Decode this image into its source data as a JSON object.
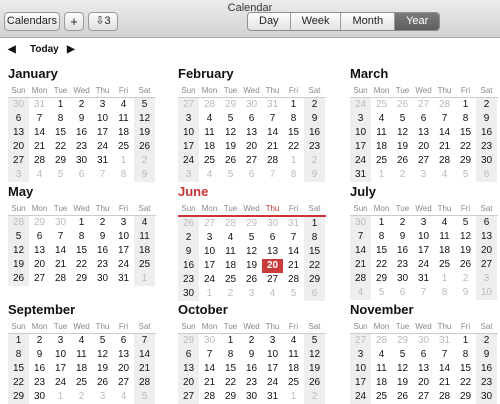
{
  "window": {
    "title": "Calendar"
  },
  "toolbar": {
    "calendars_label": "Calendars",
    "add_label": "+",
    "inbox_count": "3",
    "views": [
      "Day",
      "Week",
      "Month",
      "Year"
    ],
    "active_view": "Year"
  },
  "nav": {
    "today_label": "Today"
  },
  "weekdays": [
    "Sun",
    "Mon",
    "Tue",
    "Wed",
    "Thu",
    "Fri",
    "Sat"
  ],
  "months": [
    {
      "name": "January",
      "weeks": [
        [
          "30",
          "31",
          "1",
          "2",
          "3",
          "4",
          "5"
        ],
        [
          "6",
          "7",
          "8",
          "9",
          "10",
          "11",
          "12"
        ],
        [
          "13",
          "14",
          "15",
          "16",
          "17",
          "18",
          "19"
        ],
        [
          "20",
          "21",
          "22",
          "23",
          "24",
          "25",
          "26"
        ],
        [
          "27",
          "28",
          "29",
          "30",
          "31",
          "1",
          "2"
        ],
        [
          "3",
          "4",
          "5",
          "6",
          "7",
          "8",
          "9"
        ]
      ]
    },
    {
      "name": "February",
      "weeks": [
        [
          "27",
          "28",
          "29",
          "30",
          "31",
          "1",
          "2"
        ],
        [
          "3",
          "4",
          "5",
          "6",
          "7",
          "8",
          "9"
        ],
        [
          "10",
          "11",
          "12",
          "13",
          "14",
          "15",
          "16"
        ],
        [
          "17",
          "18",
          "19",
          "20",
          "21",
          "22",
          "23"
        ],
        [
          "24",
          "25",
          "26",
          "27",
          "28",
          "1",
          "2"
        ],
        [
          "3",
          "4",
          "5",
          "6",
          "7",
          "8",
          "9"
        ]
      ]
    },
    {
      "name": "March",
      "weeks": [
        [
          "24",
          "25",
          "26",
          "27",
          "28",
          "1",
          "2"
        ],
        [
          "3",
          "4",
          "5",
          "6",
          "7",
          "8",
          "9"
        ],
        [
          "10",
          "11",
          "12",
          "13",
          "14",
          "15",
          "16"
        ],
        [
          "17",
          "18",
          "19",
          "20",
          "21",
          "22",
          "23"
        ],
        [
          "24",
          "25",
          "26",
          "27",
          "28",
          "29",
          "30"
        ],
        [
          "31",
          "1",
          "2",
          "3",
          "4",
          "5",
          "6"
        ]
      ]
    },
    {
      "name": "May",
      "weeks": [
        [
          "28",
          "29",
          "30",
          "1",
          "2",
          "3",
          "4"
        ],
        [
          "5",
          "6",
          "7",
          "8",
          "9",
          "10",
          "11"
        ],
        [
          "12",
          "13",
          "14",
          "15",
          "16",
          "17",
          "18"
        ],
        [
          "19",
          "20",
          "21",
          "22",
          "23",
          "24",
          "25"
        ],
        [
          "26",
          "27",
          "28",
          "29",
          "30",
          "31",
          "1"
        ]
      ]
    },
    {
      "name": "June",
      "current": true,
      "weeks": [
        [
          "26",
          "27",
          "28",
          "29",
          "30",
          "31",
          "1"
        ],
        [
          "2",
          "3",
          "4",
          "5",
          "6",
          "7",
          "8"
        ],
        [
          "9",
          "10",
          "11",
          "12",
          "13",
          "14",
          "15"
        ],
        [
          "16",
          "17",
          "18",
          "19",
          "20",
          "21",
          "22"
        ],
        [
          "23",
          "24",
          "25",
          "26",
          "27",
          "28",
          "29"
        ],
        [
          "30",
          "1",
          "2",
          "3",
          "4",
          "5",
          "6"
        ]
      ]
    },
    {
      "name": "July",
      "weeks": [
        [
          "30",
          "1",
          "2",
          "3",
          "4",
          "5",
          "6"
        ],
        [
          "7",
          "8",
          "9",
          "10",
          "11",
          "12",
          "13"
        ],
        [
          "14",
          "15",
          "16",
          "17",
          "18",
          "19",
          "20"
        ],
        [
          "21",
          "22",
          "23",
          "24",
          "25",
          "26",
          "27"
        ],
        [
          "28",
          "29",
          "30",
          "31",
          "1",
          "2",
          "3"
        ],
        [
          "4",
          "5",
          "6",
          "7",
          "8",
          "9",
          "10"
        ]
      ]
    },
    {
      "name": "September",
      "weeks": [
        [
          "1",
          "2",
          "3",
          "4",
          "5",
          "6",
          "7"
        ],
        [
          "8",
          "9",
          "10",
          "11",
          "12",
          "13",
          "14"
        ],
        [
          "15",
          "16",
          "17",
          "18",
          "19",
          "20",
          "21"
        ],
        [
          "22",
          "23",
          "24",
          "25",
          "26",
          "27",
          "28"
        ],
        [
          "29",
          "30",
          "1",
          "2",
          "3",
          "4",
          "5"
        ]
      ]
    },
    {
      "name": "October",
      "weeks": [
        [
          "29",
          "30",
          "1",
          "2",
          "3",
          "4",
          "5"
        ],
        [
          "6",
          "7",
          "8",
          "9",
          "10",
          "11",
          "12"
        ],
        [
          "13",
          "14",
          "15",
          "16",
          "17",
          "18",
          "19"
        ],
        [
          "20",
          "21",
          "22",
          "23",
          "24",
          "25",
          "26"
        ],
        [
          "27",
          "28",
          "29",
          "30",
          "31",
          "1",
          "2"
        ]
      ]
    },
    {
      "name": "November",
      "weeks": [
        [
          "27",
          "28",
          "29",
          "30",
          "31",
          "1",
          "2"
        ],
        [
          "3",
          "4",
          "5",
          "6",
          "7",
          "8",
          "9"
        ],
        [
          "10",
          "11",
          "12",
          "13",
          "14",
          "15",
          "16"
        ],
        [
          "17",
          "18",
          "19",
          "20",
          "21",
          "22",
          "23"
        ],
        [
          "24",
          "25",
          "26",
          "27",
          "28",
          "29",
          "30"
        ]
      ]
    }
  ],
  "today": {
    "month": "June",
    "day": "20"
  },
  "colors": {
    "accent": "#cc3b3b",
    "toolbar_top": "#ececec",
    "toolbar_bottom": "#d2d2d2"
  }
}
